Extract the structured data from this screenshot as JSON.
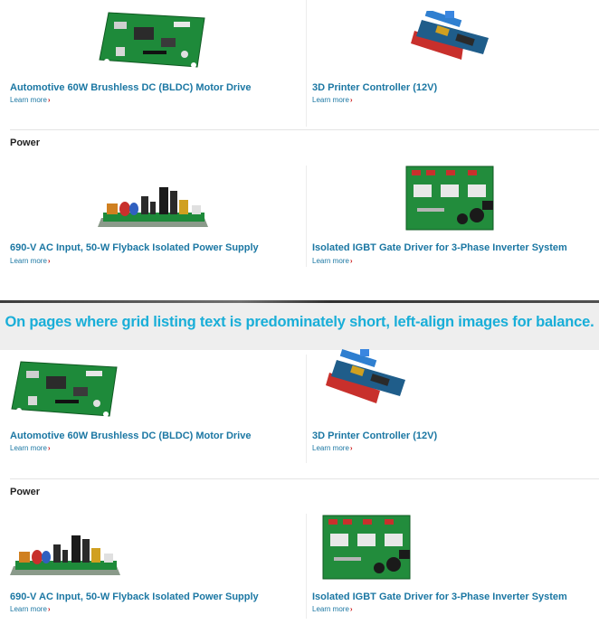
{
  "top_grid": {
    "row1": [
      {
        "title": "Automotive 60W Brushless DC (BLDC) Motor Drive",
        "link": "Learn more"
      },
      {
        "title": "3D Printer Controller (12V)",
        "link": "Learn more"
      }
    ],
    "section_label": "Power",
    "row2": [
      {
        "title": "690-V AC Input, 50-W Flyback Isolated Power Supply",
        "link": "Learn more"
      },
      {
        "title": "Isolated IGBT Gate Driver for 3-Phase Inverter System",
        "link": "Learn more"
      }
    ]
  },
  "banner": {
    "text": "On pages where grid listing text is predominately short, left-align images for balance.",
    "color": "#19aed8"
  },
  "bottom_grid": {
    "row1": [
      {
        "title": "Automotive 60W Brushless DC (BLDC) Motor Drive",
        "link": "Learn more"
      },
      {
        "title": "3D Printer Controller (12V)",
        "link": "Learn more"
      }
    ],
    "section_label": "Power",
    "row2": [
      {
        "title": "690-V AC Input, 50-W Flyback Isolated Power Supply",
        "link": "Learn more"
      },
      {
        "title": "Isolated IGBT Gate Driver for 3-Phase Inverter System",
        "link": "Learn more"
      }
    ]
  },
  "colors": {
    "link": "#1b77a3",
    "chevron": "#cc1b1b",
    "board_green": "#1f8a3c"
  }
}
